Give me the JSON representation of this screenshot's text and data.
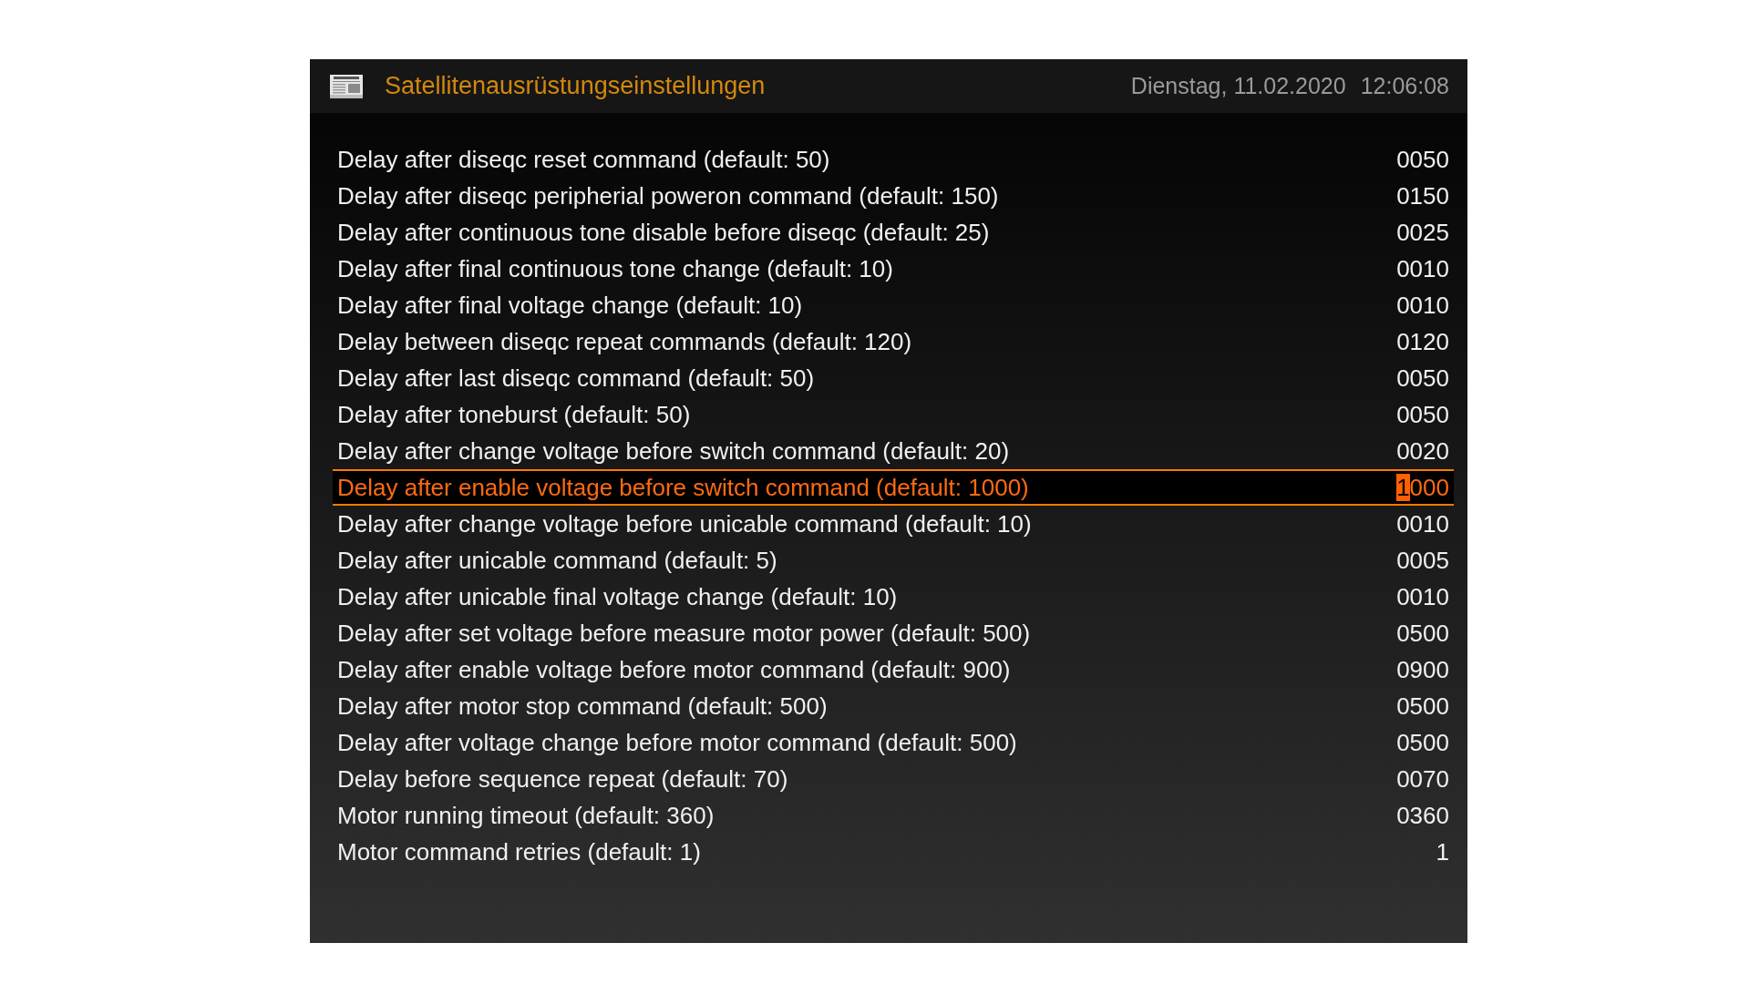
{
  "header": {
    "title": "Satellitenausrüstungseinstellungen",
    "date": "Dienstag, 11.02.2020",
    "time": "12:06:08"
  },
  "settings": [
    {
      "label": "Delay after diseqc reset command (default: 50)",
      "value": "0050",
      "selected": false
    },
    {
      "label": "Delay after diseqc peripherial poweron command (default: 150)",
      "value": "0150",
      "selected": false
    },
    {
      "label": "Delay after continuous tone disable before diseqc (default: 25)",
      "value": "0025",
      "selected": false
    },
    {
      "label": "Delay after final continuous tone change (default: 10)",
      "value": "0010",
      "selected": false
    },
    {
      "label": "Delay after final voltage change (default: 10)",
      "value": "0010",
      "selected": false
    },
    {
      "label": "Delay between diseqc repeat commands (default: 120)",
      "value": "0120",
      "selected": false
    },
    {
      "label": "Delay after last diseqc command (default: 50)",
      "value": "0050",
      "selected": false
    },
    {
      "label": "Delay after toneburst (default: 50)",
      "value": "0050",
      "selected": false
    },
    {
      "label": "Delay after change voltage before switch command (default: 20)",
      "value": "0020",
      "selected": false
    },
    {
      "label": "Delay after enable voltage before switch command (default: 1000)",
      "selected": true,
      "value_parts": [
        {
          "text": "1",
          "cursor": true
        },
        {
          "text": "000",
          "cursor": false
        }
      ]
    },
    {
      "label": "Delay after change voltage before unicable command (default: 10)",
      "value": "0010",
      "selected": false
    },
    {
      "label": "Delay after unicable command (default: 5)",
      "value": "0005",
      "selected": false
    },
    {
      "label": "Delay after unicable final voltage change (default: 10)",
      "value": "0010",
      "selected": false
    },
    {
      "label": "Delay after set voltage before measure motor power (default: 500)",
      "value": "0500",
      "selected": false
    },
    {
      "label": "Delay after enable voltage before motor command (default: 900)",
      "value": "0900",
      "selected": false
    },
    {
      "label": "Delay after motor stop command (default: 500)",
      "value": "0500",
      "selected": false
    },
    {
      "label": "Delay after voltage change before motor command (default: 500)",
      "value": "0500",
      "selected": false
    },
    {
      "label": "Delay before sequence repeat (default: 70)",
      "value": "0070",
      "selected": false
    },
    {
      "label": "Motor running timeout (default: 360)",
      "value": "0360",
      "selected": false
    },
    {
      "label": "Motor command retries (default: 1)",
      "value": "1",
      "selected": false
    }
  ]
}
